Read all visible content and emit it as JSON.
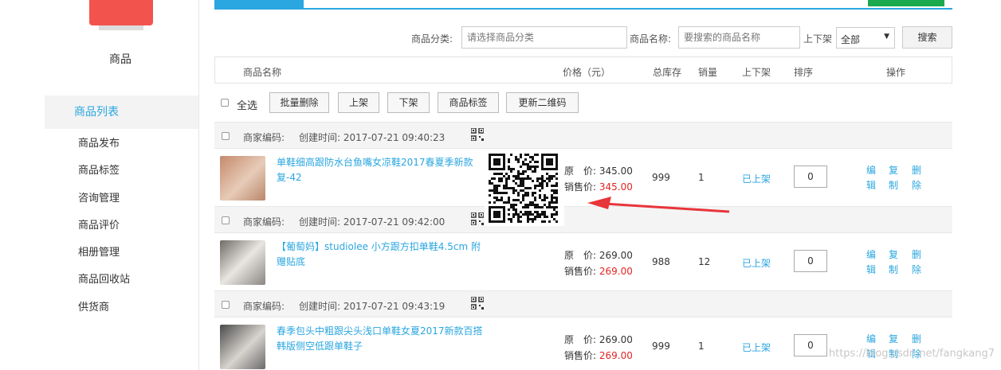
{
  "sidebar": {
    "section_title": "商品",
    "active_item": "商品列表",
    "items": [
      "商品发布",
      "商品标签",
      "咨询管理",
      "商品评价",
      "相册管理",
      "商品回收站",
      "供货商"
    ]
  },
  "filter": {
    "category_label": "商品分类:",
    "category_placeholder": "请选择商品分类",
    "name_label": "商品名称:",
    "name_placeholder": "要搜索的商品名称",
    "shelf_label": "上下架",
    "shelf_value": "全部",
    "search_button": "搜索"
  },
  "table": {
    "headers": {
      "name": "商品名称",
      "price": "价格（元）",
      "stock": "总库存",
      "sales": "销量",
      "shelf": "上下架",
      "sort": "排序",
      "ops": "操作"
    }
  },
  "batch": {
    "select_all": "全选",
    "buttons": [
      "批量删除",
      "上架",
      "下架",
      "商品标签",
      "更新二维码"
    ]
  },
  "products": [
    {
      "code_label": "商家编码:",
      "created": "创建时间: 2017-07-21 09:40:23",
      "name": "单鞋细高跟防水台鱼嘴女凉鞋2017春夏季新款复-42",
      "orig_price": "原　价: 345.00",
      "sale_label": "销售价:",
      "sale_price": "345.00",
      "stock": "999",
      "sales": "1",
      "status": "已上架",
      "sort": "0"
    },
    {
      "code_label": "商家编码:",
      "created": "创建时间: 2017-07-21 09:42:00",
      "name": "【葡萄妈】studiolee 小方跟方扣单鞋4.5cm 附赠贴底",
      "orig_price": "原　价: 269.00",
      "sale_label": "销售价:",
      "sale_price": "269.00",
      "stock": "988",
      "sales": "12",
      "status": "已上架",
      "sort": "0"
    },
    {
      "code_label": "商家编码:",
      "created": "创建时间: 2017-07-21 09:43:19",
      "name": "春季包头中粗跟尖头浅口单鞋女夏2017新款百搭韩版侧空低跟单鞋子",
      "orig_price": "原　价: 269.00",
      "sale_label": "销售价:",
      "sale_price": "269.00",
      "stock": "999",
      "sales": "1",
      "status": "已上架",
      "sort": "0"
    }
  ],
  "ops": {
    "edit": "编辑",
    "copy": "复制",
    "delete": "删除"
  },
  "watermark": "https://blog.csdn.net/fangkang7",
  "colors": {
    "accent": "#2aa6e0",
    "price_red": "#e52424",
    "arrow_red": "#e8353a",
    "green": "#1aa94c"
  }
}
